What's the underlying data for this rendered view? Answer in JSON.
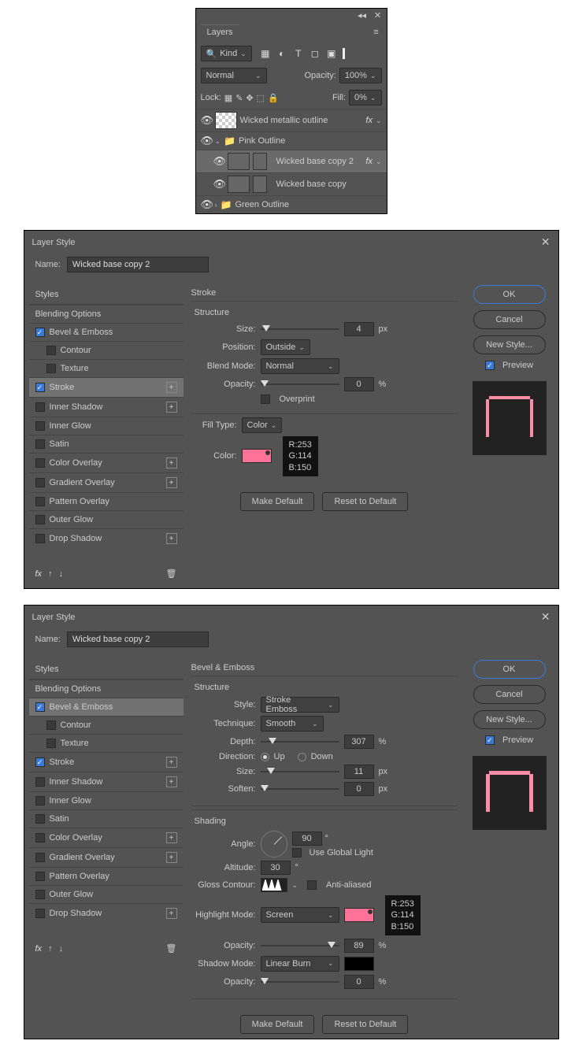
{
  "layers_panel": {
    "title": "Layers",
    "kind": "Kind",
    "blend_mode": "Normal",
    "opacity_label": "Opacity:",
    "opacity_value": "100%",
    "lock_label": "Lock:",
    "fill_label": "Fill:",
    "fill_value": "0%",
    "items": [
      {
        "name": "Wicked metallic outline",
        "fx": "fx"
      },
      {
        "name": "Pink Outline",
        "type": "folder"
      },
      {
        "name": "Wicked base copy 2",
        "fx": "fx",
        "selected": true
      },
      {
        "name": "Wicked base copy"
      },
      {
        "name": "Green Outline",
        "type": "folder"
      }
    ]
  },
  "dialog1": {
    "title": "Layer Style",
    "name_label": "Name:",
    "name_value": "Wicked base copy 2",
    "styles_header": "Styles",
    "fx_label": "fx",
    "style_list": [
      {
        "label": "Blending Options",
        "chk": null
      },
      {
        "label": "Bevel & Emboss",
        "chk": true
      },
      {
        "label": "Contour",
        "chk": false,
        "sub": true
      },
      {
        "label": "Texture",
        "chk": false,
        "sub": true
      },
      {
        "label": "Stroke",
        "chk": true,
        "plus": true,
        "selected": true
      },
      {
        "label": "Inner Shadow",
        "chk": false,
        "plus": true
      },
      {
        "label": "Inner Glow",
        "chk": false
      },
      {
        "label": "Satin",
        "chk": false
      },
      {
        "label": "Color Overlay",
        "chk": false,
        "plus": true
      },
      {
        "label": "Gradient Overlay",
        "chk": false,
        "plus": true
      },
      {
        "label": "Pattern Overlay",
        "chk": false
      },
      {
        "label": "Outer Glow",
        "chk": false
      },
      {
        "label": "Drop Shadow",
        "chk": false,
        "plus": true
      }
    ],
    "section": "Stroke",
    "structure_label": "Structure",
    "size_label": "Size:",
    "size_value": "4",
    "px": "px",
    "position_label": "Position:",
    "position_value": "Outside",
    "blend_mode_label": "Blend Mode:",
    "blend_mode_value": "Normal",
    "opacity_label": "Opacity:",
    "opacity_value": "0",
    "pct": "%",
    "overprint_label": "Overprint",
    "fill_type_label": "Fill Type:",
    "fill_type_value": "Color",
    "color_label": "Color:",
    "swatch": "#fd7296",
    "rgb": {
      "r": "R:253",
      "g": "G:114",
      "b": "B:150"
    },
    "make_default": "Make Default",
    "reset_default": "Reset to Default",
    "ok": "OK",
    "cancel": "Cancel",
    "new_style": "New Style...",
    "preview": "Preview"
  },
  "dialog2": {
    "title": "Layer Style",
    "name_label": "Name:",
    "name_value": "Wicked base copy 2",
    "styles_header": "Styles",
    "fx_label": "fx",
    "style_list": [
      {
        "label": "Blending Options",
        "chk": null
      },
      {
        "label": "Bevel & Emboss",
        "chk": true,
        "selected": true
      },
      {
        "label": "Contour",
        "chk": false,
        "sub": true
      },
      {
        "label": "Texture",
        "chk": false,
        "sub": true
      },
      {
        "label": "Stroke",
        "chk": true,
        "plus": true
      },
      {
        "label": "Inner Shadow",
        "chk": false,
        "plus": true
      },
      {
        "label": "Inner Glow",
        "chk": false
      },
      {
        "label": "Satin",
        "chk": false
      },
      {
        "label": "Color Overlay",
        "chk": false,
        "plus": true
      },
      {
        "label": "Gradient Overlay",
        "chk": false,
        "plus": true
      },
      {
        "label": "Pattern Overlay",
        "chk": false
      },
      {
        "label": "Outer Glow",
        "chk": false
      },
      {
        "label": "Drop Shadow",
        "chk": false,
        "plus": true
      }
    ],
    "section": "Bevel & Emboss",
    "structure_label": "Structure",
    "style_label": "Style:",
    "style_value": "Stroke Emboss",
    "technique_label": "Technique:",
    "technique_value": "Smooth",
    "depth_label": "Depth:",
    "depth_value": "307",
    "direction_label": "Direction:",
    "up": "Up",
    "down": "Down",
    "size_label": "Size:",
    "size_value": "11",
    "soften_label": "Soften:",
    "soften_value": "0",
    "px": "px",
    "pct": "%",
    "shading_label": "Shading",
    "angle_label": "Angle:",
    "angle_value": "90",
    "deg": "°",
    "use_global": "Use Global Light",
    "altitude_label": "Altitude:",
    "altitude_value": "30",
    "gloss_label": "Gloss Contour:",
    "anti_aliased": "Anti-aliased",
    "highlight_mode_label": "Highlight Mode:",
    "highlight_mode_value": "Screen",
    "highlight_swatch": "#fd7296",
    "opacity_label": "Opacity:",
    "hl_opacity_value": "89",
    "shadow_mode_label": "Shadow Mode:",
    "shadow_mode_value": "Linear Burn",
    "shadow_swatch": "#000000",
    "sh_opacity_value": "0",
    "rgb": {
      "r": "R:253",
      "g": "G:114",
      "b": "B:150"
    },
    "make_default": "Make Default",
    "reset_default": "Reset to Default",
    "ok": "OK",
    "cancel": "Cancel",
    "new_style": "New Style...",
    "preview": "Preview"
  }
}
